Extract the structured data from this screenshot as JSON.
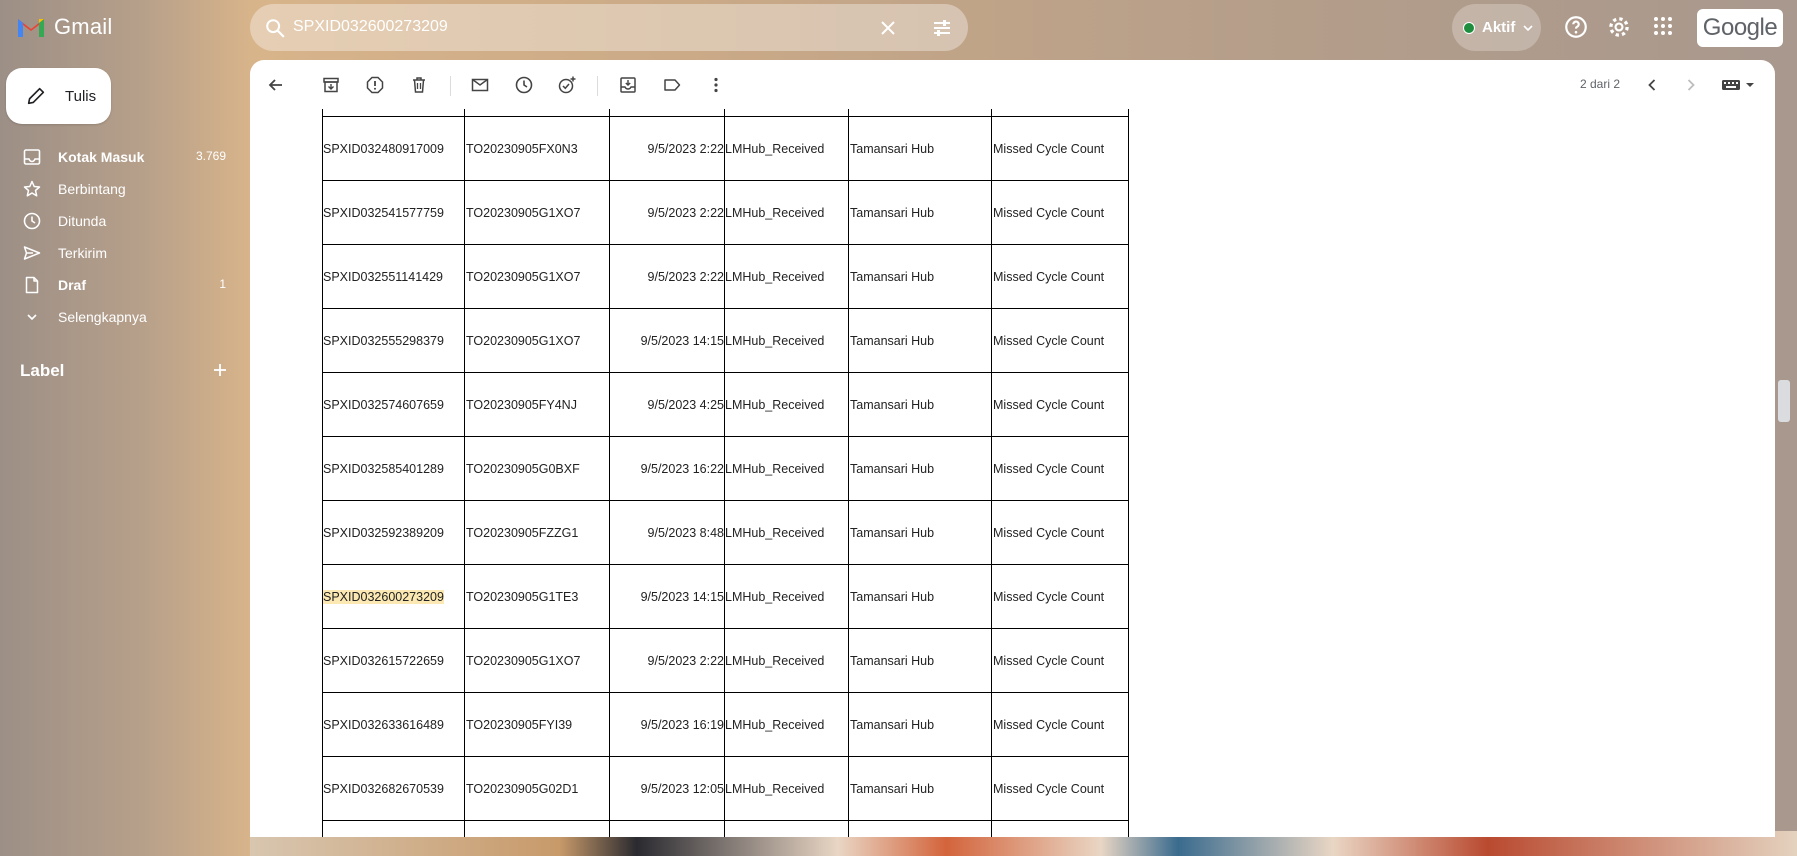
{
  "app": {
    "name": "Gmail"
  },
  "search": {
    "query": "SPXID032600273209"
  },
  "status": {
    "label": "Aktif"
  },
  "brand_badge": "Google",
  "compose": {
    "label": "Tulis"
  },
  "sidebar": {
    "items": [
      {
        "label": "Kotak Masuk",
        "count": "3.769"
      },
      {
        "label": "Berbintang",
        "count": ""
      },
      {
        "label": "Ditunda",
        "count": ""
      },
      {
        "label": "Terkirim",
        "count": ""
      },
      {
        "label": "Draf",
        "count": "1"
      },
      {
        "label": "Selengkapnya",
        "count": ""
      }
    ],
    "label_heading": "Label"
  },
  "toolbar": {
    "pager": "2 dari 2"
  },
  "table": {
    "rows": [
      [
        "SPXID032480917009",
        "TO20230905FX0N3",
        "9/5/2023 2:22",
        "LMHub_Received",
        "Tamansari Hub",
        "Missed Cycle Count"
      ],
      [
        "SPXID032541577759",
        "TO20230905G1XO7",
        "9/5/2023 2:22",
        "LMHub_Received",
        "Tamansari Hub",
        "Missed Cycle Count"
      ],
      [
        "SPXID032551141429",
        "TO20230905G1XO7",
        "9/5/2023 2:22",
        "LMHub_Received",
        "Tamansari Hub",
        "Missed Cycle Count"
      ],
      [
        "SPXID032555298379",
        "TO20230905G1XO7",
        "9/5/2023 14:15",
        "LMHub_Received",
        "Tamansari Hub",
        "Missed Cycle Count"
      ],
      [
        "SPXID032574607659",
        "TO20230905FY4NJ",
        "9/5/2023 4:25",
        "LMHub_Received",
        "Tamansari Hub",
        "Missed Cycle Count"
      ],
      [
        "SPXID032585401289",
        "TO20230905G0BXF",
        "9/5/2023 16:22",
        "LMHub_Received",
        "Tamansari Hub",
        "Missed Cycle Count"
      ],
      [
        "SPXID032592389209",
        "TO20230905FZZG1",
        "9/5/2023 8:48",
        "LMHub_Received",
        "Tamansari Hub",
        "Missed Cycle Count"
      ],
      [
        "SPXID032600273209",
        "TO20230905G1TE3",
        "9/5/2023 14:15",
        "LMHub_Received",
        "Tamansari Hub",
        "Missed Cycle Count"
      ],
      [
        "SPXID032615722659",
        "TO20230905G1XO7",
        "9/5/2023 2:22",
        "LMHub_Received",
        "Tamansari Hub",
        "Missed Cycle Count"
      ],
      [
        "SPXID032633616489",
        "TO20230905FYI39",
        "9/5/2023 16:19",
        "LMHub_Received",
        "Tamansari Hub",
        "Missed Cycle Count"
      ],
      [
        "SPXID032682670539",
        "TO20230905G02D1",
        "9/5/2023 12:05",
        "LMHub_Received",
        "Tamansari Hub",
        "Missed Cycle Count"
      ]
    ],
    "highlight_row": 7,
    "highlight_color": "#fce8b2"
  }
}
